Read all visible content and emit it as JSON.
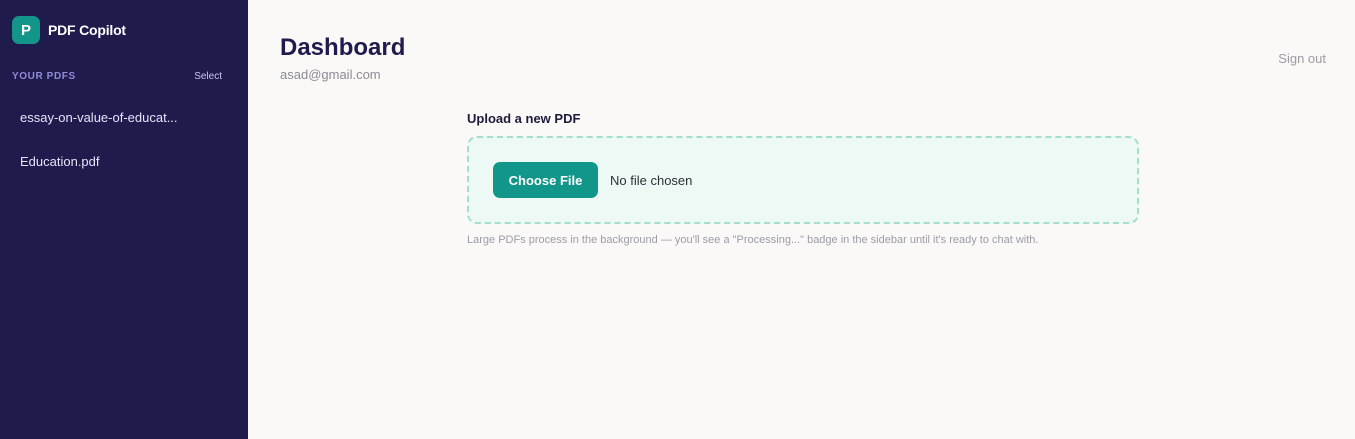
{
  "brand": {
    "logo_letter": "P",
    "name": "PDF Copilot"
  },
  "sidebar": {
    "section_title": "YOUR PDFS",
    "select_label": "Select",
    "items": [
      {
        "label": "essay-on-value-of-educat..."
      },
      {
        "label": "Education.pdf"
      }
    ]
  },
  "header": {
    "title": "Dashboard",
    "email": "asad@gmail.com",
    "sign_out": "Sign out"
  },
  "upload": {
    "label": "Upload a new PDF",
    "button_label": "Choose File",
    "status": "No file chosen",
    "hint": "Large PDFs process in the background — you'll see a \"Processing...\" badge in the sidebar until it's ready to chat with."
  },
  "colors": {
    "sidebar_bg": "#1f1b4d",
    "accent": "#13968a",
    "dropzone_bg": "#ecf9f4",
    "dropzone_border": "#a5dfc9",
    "page_bg": "#faf9f7"
  }
}
